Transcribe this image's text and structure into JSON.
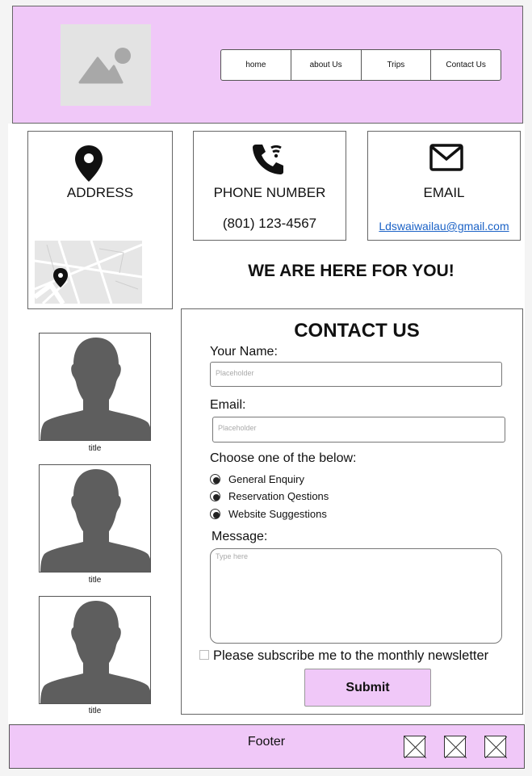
{
  "nav": {
    "items": [
      "home",
      "about Us",
      "Trips",
      "Contact Us"
    ]
  },
  "contact_cards": {
    "address": {
      "title": "ADDRESS"
    },
    "phone": {
      "title": "PHONE NUMBER",
      "value": "(801) 123-4567"
    },
    "email": {
      "title": "EMAIL",
      "value": "Ldswaiwailau@gmail.com"
    }
  },
  "tagline": "WE ARE HERE FOR YOU!",
  "team": [
    {
      "caption": "title"
    },
    {
      "caption": "title"
    },
    {
      "caption": "title"
    }
  ],
  "form": {
    "title": "CONTACT US",
    "name_label": "Your Name:",
    "name_placeholder": "Placeholder",
    "email_label": "Email:",
    "email_placeholder": "Placeholder",
    "choose_label": "Choose one of the below:",
    "options": [
      "General Enquiry",
      "Reservation Qestions",
      "Website Suggestions"
    ],
    "message_label": "Message:",
    "message_placeholder": "Type here",
    "newsletter_label": "Please subscribe me to the monthly newsletter",
    "submit_label": "Submit"
  },
  "footer": {
    "text": "Footer",
    "icons": [
      "placeholder-icon",
      "placeholder-icon",
      "placeholder-icon"
    ]
  },
  "colors": {
    "accent": "#f0c8f8",
    "link": "#1b62c6",
    "icon_gray": "#5e5e5e"
  }
}
